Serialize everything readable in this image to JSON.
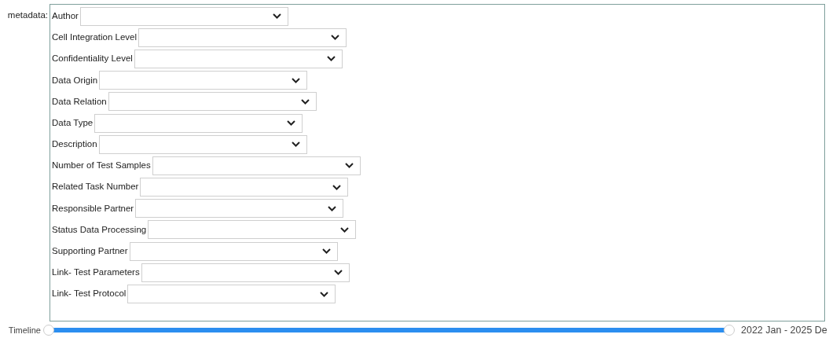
{
  "metadata": {
    "label": "metadata:",
    "fields": [
      {
        "label": "Author"
      },
      {
        "label": "Cell Integration Level"
      },
      {
        "label": "Confidentiality Level"
      },
      {
        "label": "Data Origin"
      },
      {
        "label": "Data Relation"
      },
      {
        "label": "Data Type"
      },
      {
        "label": "Description"
      },
      {
        "label": "Number of Test Samples"
      },
      {
        "label": "Related Task Number"
      },
      {
        "label": "Responsible Partner"
      },
      {
        "label": "Status Data Processing"
      },
      {
        "label": "Supporting Partner"
      },
      {
        "label": "Link- Test Parameters"
      },
      {
        "label": "Link- Test Protocol"
      }
    ]
  },
  "timeline": {
    "label": "Timeline",
    "thumbs": [
      {
        "level": 0
      },
      {
        "level": 1
      }
    ],
    "reading": "2022 Jan - 2025 De"
  }
}
